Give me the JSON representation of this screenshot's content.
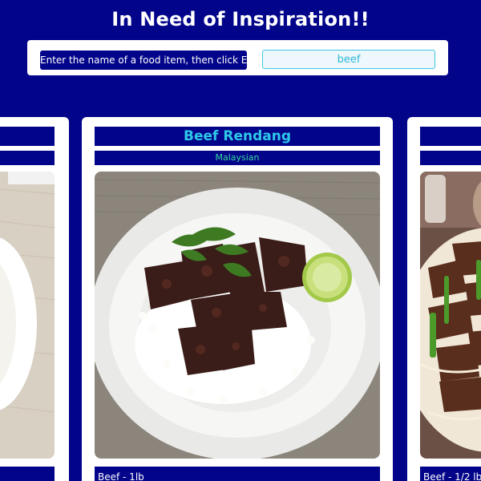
{
  "header": {
    "title": "In Need of Inspiration!!"
  },
  "search": {
    "label": "Enter the name of a food item, then click Enter!",
    "value": "beef"
  },
  "cards": [
    {
      "title": "",
      "cuisine": "",
      "ingredient": ""
    },
    {
      "title": "Beef Rendang",
      "cuisine": "Malaysian",
      "ingredient": "Beef - 1lb"
    },
    {
      "title": "",
      "cuisine": "",
      "ingredient": "Beef - 1/2 lb"
    }
  ],
  "colors": {
    "background": "#02048a",
    "accent_title": "#2ec8e8",
    "accent_cuisine": "#38d89c",
    "card": "#ffffff"
  },
  "icons": {
    "card_image_1": "food-photo-icon",
    "card_image_2": "beef-rendang-photo-icon",
    "card_image_3": "beef-stirfry-photo-icon"
  }
}
